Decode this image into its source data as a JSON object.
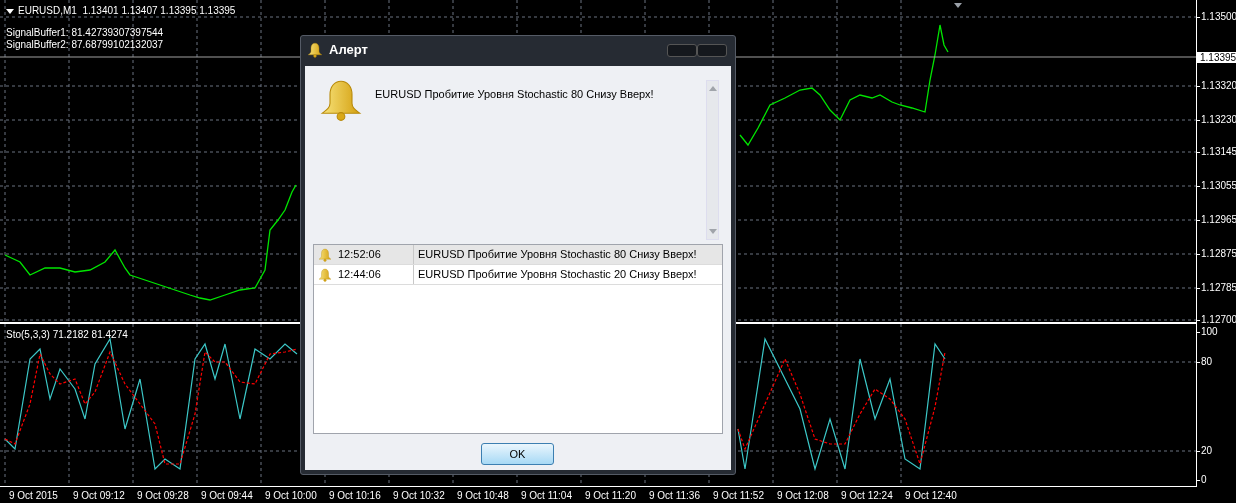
{
  "chart": {
    "symbol_header": "EURUSD,M1  1.13401 1.13407 1.13395 1.13395",
    "indicator_lines": [
      "SignalBuffer1: 81.42739307397544",
      "SignalBuffer2: 87.68799102132037"
    ],
    "current_price": "1.13395",
    "price_axis_labels": [
      "1.13500",
      "1.13320",
      "1.13230",
      "1.13145",
      "1.13055",
      "1.12965",
      "1.12875",
      "1.12785",
      "1.12700"
    ]
  },
  "stochastic": {
    "title": "Sto(5,3,3) 71.2182 81.4274",
    "axis_labels": [
      "100",
      "80",
      "20",
      "0"
    ]
  },
  "time_axis_labels": [
    "9 Oct 2015",
    "9 Oct 09:12",
    "9 Oct 09:28",
    "9 Oct 09:44",
    "9 Oct 10:00",
    "9 Oct 10:16",
    "9 Oct 10:32",
    "9 Oct 10:48",
    "9 Oct 11:04",
    "9 Oct 11:20",
    "9 Oct 11:36",
    "9 Oct 11:52",
    "9 Oct 12:08",
    "9 Oct 12:24",
    "9 Oct 12:40"
  ],
  "alert_dialog": {
    "title": "Алерт",
    "message": "EURUSD Пробитие Уровня Stochastic 80 Снизу Вверх!",
    "history": [
      {
        "time": "12:52:06",
        "message": "EURUSD Пробитие Уровня Stochastic 80 Снизу Вверх!",
        "selected": true
      },
      {
        "time": "12:44:06",
        "message": "EURUSD Пробитие Уровня Stochastic 20 Снизу Вверх!",
        "selected": false
      }
    ],
    "ok_button": "OK"
  }
}
